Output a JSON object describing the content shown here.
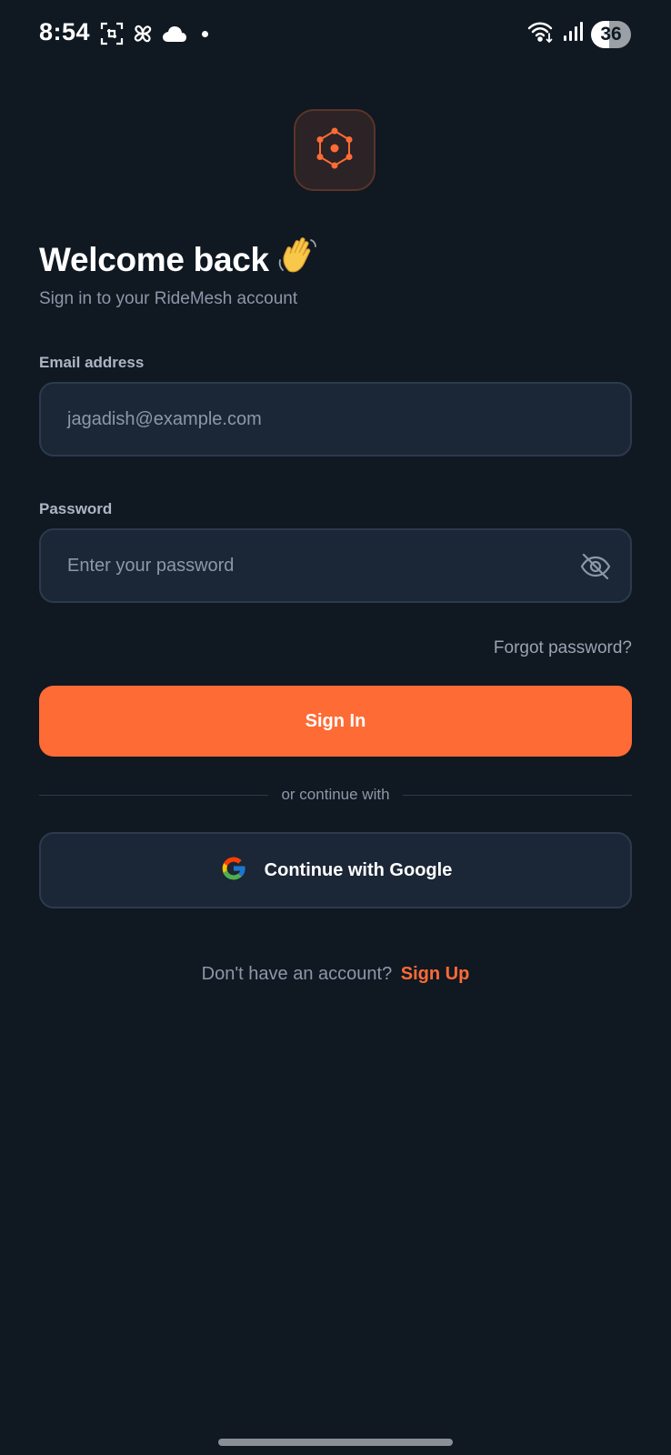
{
  "status_bar": {
    "time": "8:54",
    "battery": "36",
    "icons": [
      "screenshot-icon",
      "pinwheel-icon",
      "cloud-icon",
      "notification-dot",
      "wifi-icon",
      "signal-icon",
      "battery-icon"
    ]
  },
  "logo": {
    "icon": "network-hub-icon",
    "accent_color": "#ff6b35"
  },
  "header": {
    "title": "Welcome back",
    "emoji": "waving-hand-icon",
    "subtitle": "Sign in to your RideMesh account"
  },
  "form": {
    "email_label": "Email address",
    "email_placeholder": "jagadish@example.com",
    "password_label": "Password",
    "password_placeholder": "Enter your password",
    "password_toggle_icon": "eye-off-icon",
    "forgot_label": "Forgot password?",
    "submit_label": "Sign In"
  },
  "divider": {
    "text": "or continue with"
  },
  "social": {
    "google_label": "Continue with Google",
    "google_icon": "google-icon"
  },
  "footer": {
    "prompt": "Don't have an account?",
    "signup_label": "Sign Up"
  },
  "colors": {
    "background": "#101822",
    "accent": "#ff6b35",
    "field_background": "#1b2636",
    "field_border": "#2c3a4e",
    "muted_text": "#8d97a8"
  }
}
